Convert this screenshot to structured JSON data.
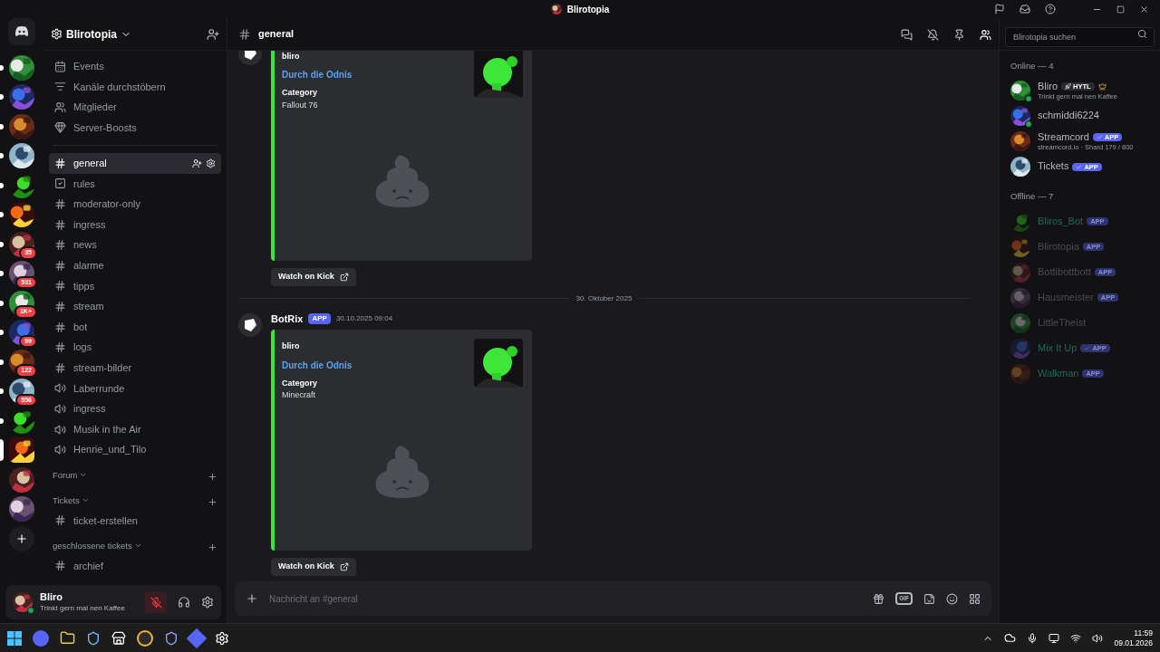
{
  "window": {
    "title": "Blirotopia"
  },
  "servers": [
    {
      "unread": true,
      "selected": false
    },
    {
      "unread": true,
      "selected": false
    },
    {
      "unread": true,
      "selected": false
    },
    {
      "unread": true,
      "selected": false
    },
    {
      "unread": true,
      "selected": false
    },
    {
      "unread": true,
      "selected": false
    },
    {
      "unread": true,
      "selected": false,
      "badge": "35"
    },
    {
      "unread": true,
      "selected": false,
      "badge": "531"
    },
    {
      "unread": true,
      "selected": false,
      "badge": "1K+"
    },
    {
      "unread": true,
      "selected": false,
      "badge": "99"
    },
    {
      "unread": true,
      "selected": false,
      "badge": "122"
    },
    {
      "unread": true,
      "selected": false,
      "badge": "556"
    },
    {
      "unread": true,
      "selected": false
    },
    {
      "selected": true
    },
    {
      "unread": false,
      "selected": false
    },
    {
      "unread": false,
      "selected": false
    }
  ],
  "server": {
    "name": "Blirotopia"
  },
  "nav_items": [
    {
      "kind": "events",
      "label": "Events"
    },
    {
      "kind": "browse",
      "label": "Kanäle durchstöbern"
    },
    {
      "kind": "members",
      "label": "Mitglieder"
    },
    {
      "kind": "boosts",
      "label": "Server-Boosts"
    }
  ],
  "channels": [
    {
      "kind": "text",
      "name": "general",
      "selected": true
    },
    {
      "kind": "rules",
      "name": "rules",
      "selected": false
    },
    {
      "kind": "private",
      "name": "moderator-only",
      "selected": false
    },
    {
      "kind": "text",
      "name": "ingress",
      "selected": false
    },
    {
      "kind": "text",
      "name": "news",
      "selected": false
    },
    {
      "kind": "text",
      "name": "alarme",
      "selected": false
    },
    {
      "kind": "text",
      "name": "tipps",
      "selected": false
    },
    {
      "kind": "text",
      "name": "stream",
      "selected": false
    },
    {
      "kind": "text",
      "name": "bot",
      "selected": false
    },
    {
      "kind": "text",
      "name": "logs",
      "selected": false
    },
    {
      "kind": "text",
      "name": "stream-bilder",
      "selected": false
    },
    {
      "kind": "voice",
      "name": "Laberrunde",
      "selected": false
    },
    {
      "kind": "voice",
      "name": "ingress",
      "selected": false
    },
    {
      "kind": "voice",
      "name": "Musik in the Air",
      "selected": false
    },
    {
      "kind": "voice",
      "name": "Henrie_und_Tilo",
      "selected": false
    }
  ],
  "categories": [
    {
      "name": "Forum"
    },
    {
      "name": "Tickets",
      "channels": [
        {
          "name": "ticket-erstellen"
        }
      ]
    },
    {
      "name": "geschlossene tickets",
      "channels": [
        {
          "name": "archief"
        }
      ]
    }
  ],
  "user_panel": {
    "name": "Bliro",
    "status": "Trinkt gern mal nen Kaffee",
    "muted": true
  },
  "channel_header": {
    "name": "general",
    "search_placeholder": "Blirotopia suchen"
  },
  "messages": [
    {
      "kind": "embed",
      "embed": {
        "author": "bliro",
        "title": "Durch die Odnis",
        "field_name": "Category",
        "field_value": "Fallout 76"
      },
      "button": "Watch on Kick"
    },
    {
      "kind": "divider",
      "text": "30. Oktober 2025"
    },
    {
      "kind": "embed",
      "author": "BotRix",
      "tag": "APP",
      "time": "30.10.2025 09:04",
      "embed": {
        "author": "bliro",
        "title": "Durch die Odnis",
        "field_name": "Category",
        "field_value": "Minecraft"
      },
      "button": "Watch on Kick"
    }
  ],
  "composer": {
    "placeholder": "Nachricht an #general",
    "gif_label": "GIF"
  },
  "members": {
    "groups": [
      {
        "title": "Online — 4",
        "items": [
          {
            "name": "Bliro",
            "color": "#b5bac1",
            "offline": false,
            "online_dot": true,
            "guild_tag": "HYTL",
            "crown": true,
            "status": "Trinkt gern mal nen Kaffee"
          },
          {
            "name": "schmiddi6224",
            "color": "#b5bac1",
            "offline": false,
            "online_dot": true
          },
          {
            "name": "Streamcord",
            "color": "#b5bac1",
            "offline": false,
            "online_dot": false,
            "tag": "APP",
            "verified": true,
            "status": "streamcord.io · Shard 179 / 800"
          },
          {
            "name": "Tickets",
            "color": "#b5bac1",
            "offline": false,
            "online_dot": false,
            "tag": "APP",
            "verified": true
          }
        ]
      },
      {
        "title": "Offline — 7",
        "items": [
          {
            "name": "Bliros_Bot",
            "color": "#1e6b55",
            "offline": true,
            "online_dot": false,
            "tag": "APP",
            "verified": false
          },
          {
            "name": "Blirotopia",
            "color": "#4a4c52",
            "offline": true,
            "online_dot": false,
            "tag": "APP",
            "verified": false
          },
          {
            "name": "Bottibottbott",
            "color": "#4a4c52",
            "offline": true,
            "online_dot": false,
            "tag": "APP",
            "verified": false
          },
          {
            "name": "Hausmeister",
            "color": "#4a4c52",
            "offline": true,
            "online_dot": false,
            "tag": "APP",
            "verified": false
          },
          {
            "name": "LittleTheist",
            "color": "#4a4c52",
            "offline": true,
            "online_dot": false
          },
          {
            "name": "Mix It Up",
            "color": "#1e6b55",
            "offline": true,
            "online_dot": false,
            "tag": "APP",
            "verified": true
          },
          {
            "name": "Walkman",
            "color": "#1e6b55",
            "offline": true,
            "online_dot": false,
            "tag": "APP",
            "verified": false
          }
        ]
      }
    ]
  },
  "taskbar": {
    "time": "11:59",
    "date": "09.01.2026"
  }
}
